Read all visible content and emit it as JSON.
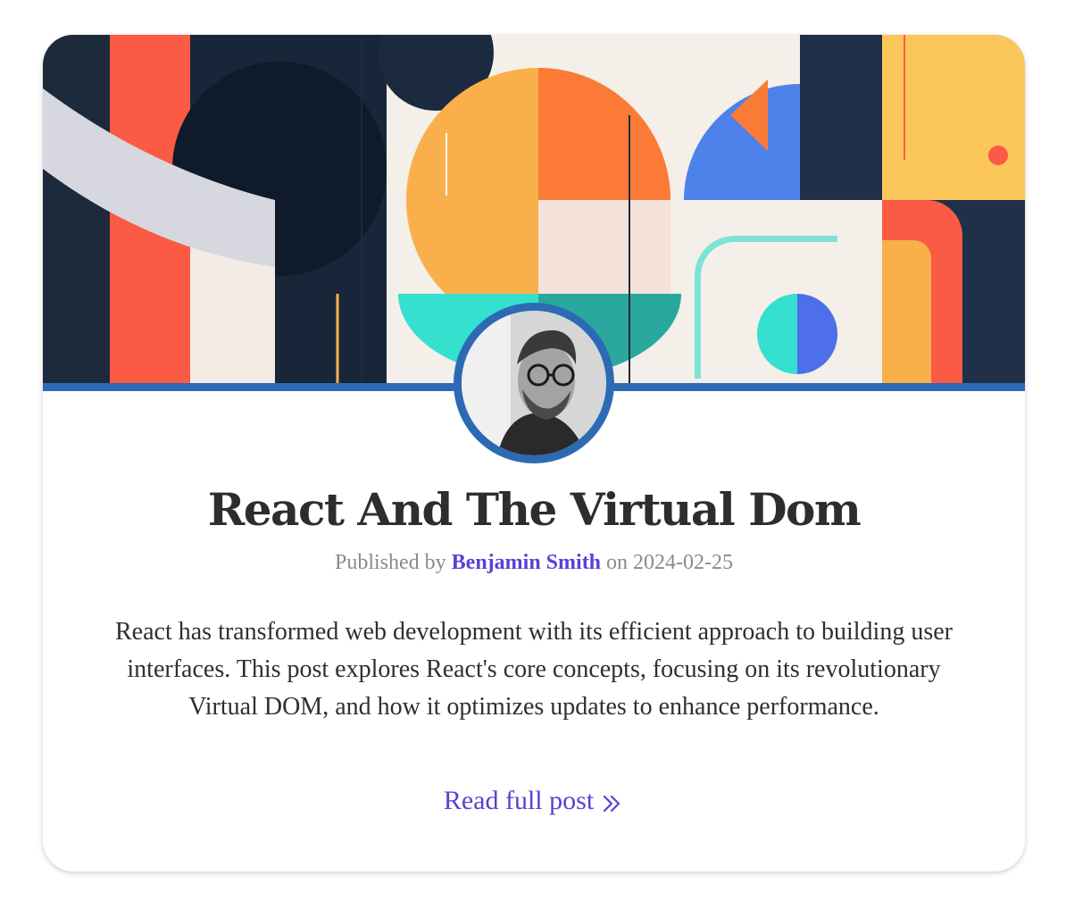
{
  "post": {
    "title": "React And The Virtual Dom",
    "meta": {
      "prefix": "Published by",
      "author": "Benjamin Smith",
      "on": "on",
      "date": "2024-02-25"
    },
    "summary": "React has transformed web development with its efficient approach to building user interfaces. This post explores React's core concepts, focusing on its revolutionary Virtual DOM, and how it optimizes updates to enhance performance.",
    "read_more_label": "Read full post",
    "read_more_icon": "double-chevron-right-icon"
  },
  "banner": {
    "icon": "abstract-geometric-banner-image"
  },
  "avatar": {
    "icon": "author-avatar-photo"
  },
  "colors": {
    "accent": "#5b3fd6",
    "stripe": "#2d6ab4",
    "title": "#2d2d2d",
    "muted": "#8a8a8a"
  }
}
